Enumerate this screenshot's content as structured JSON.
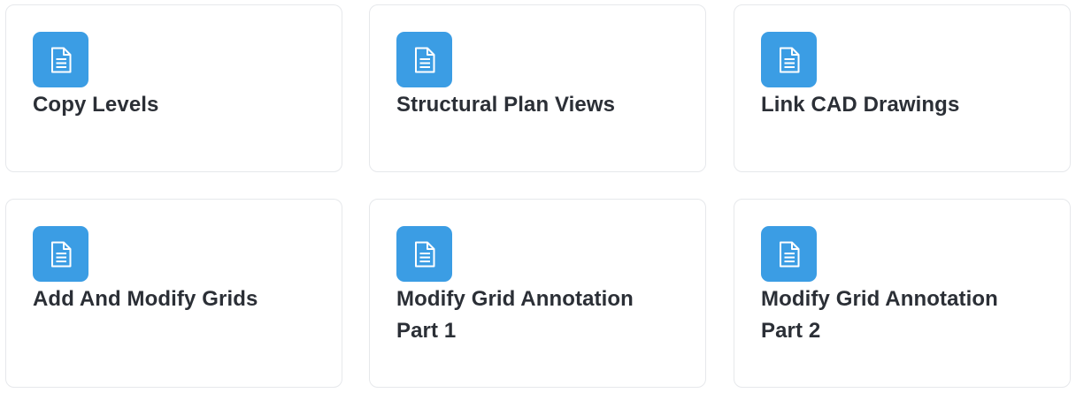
{
  "theme": {
    "accent": "#3b9de4",
    "title_color": "#2b2f36",
    "border_color": "#e6e8eb"
  },
  "cards": [
    {
      "title": "Copy Levels",
      "icon": "document-icon"
    },
    {
      "title": "Structural Plan Views",
      "icon": "document-icon"
    },
    {
      "title": "Link CAD Drawings",
      "icon": "document-icon"
    },
    {
      "title": "Add And Modify Grids",
      "icon": "document-icon"
    },
    {
      "title": "Modify Grid Annotation Part 1",
      "icon": "document-icon"
    },
    {
      "title": "Modify Grid Annotation Part 2",
      "icon": "document-icon"
    }
  ]
}
